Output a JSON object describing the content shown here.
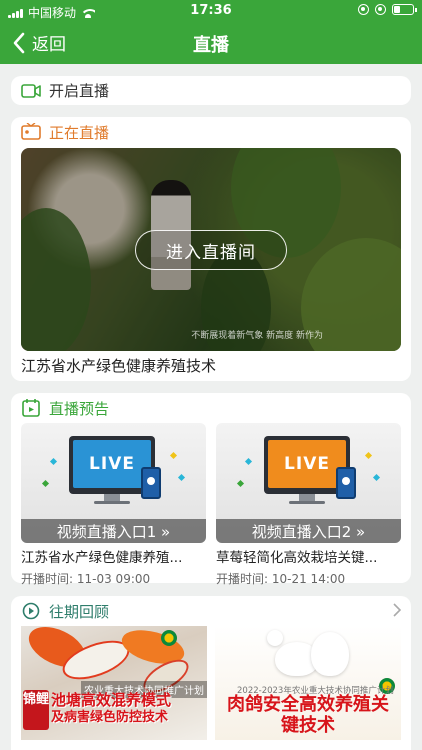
{
  "status_bar": {
    "carrier": "中国移动",
    "time": "17:36",
    "battery_level": 0.35
  },
  "nav": {
    "back_label": "返回",
    "title": "直播"
  },
  "start_live": {
    "label": "开启直播",
    "icon": "video-camera-icon"
  },
  "now_live": {
    "label": "正在直播",
    "icon": "live-screen-icon",
    "enter_button": "进入直播间",
    "video_watermark": "不断展现着新气象 新高度 新作为",
    "caption": "江苏省水产绿色健康养殖技术"
  },
  "preview": {
    "label": "直播预告",
    "icon": "calendar-icon",
    "time_prefix": "开播时间:",
    "items": [
      {
        "thumb_text": "LIVE",
        "entry_label": "视频直播入口1 »",
        "title": "江苏省水产绿色健康养殖...",
        "time": "11-03 09:00",
        "screen_color": "#2a93d5"
      },
      {
        "thumb_text": "LIVE",
        "entry_label": "视频直播入口2 »",
        "title": "草莓轻简化高效栽培关键...",
        "time": "10-21 14:00",
        "screen_color": "#f08c1d"
      }
    ]
  },
  "replay": {
    "label": "往期回顾",
    "icon": "replay-icon",
    "items": [
      {
        "tag": "锦鲤",
        "plan": "农业重大技术协同推广计划",
        "title_line1": "池塘高效混养模式",
        "title_line2": "及病害绿色防控技术"
      },
      {
        "plan": "2022-2023年农业重大技术协同推广计划",
        "title": "肉鸽安全高效养殖关键技术"
      }
    ]
  },
  "colors": {
    "brand_green": "#3aa63a",
    "live_orange": "#e07b2c",
    "preview_green": "#3aa63a",
    "replay_teal": "#2e7d6b"
  }
}
